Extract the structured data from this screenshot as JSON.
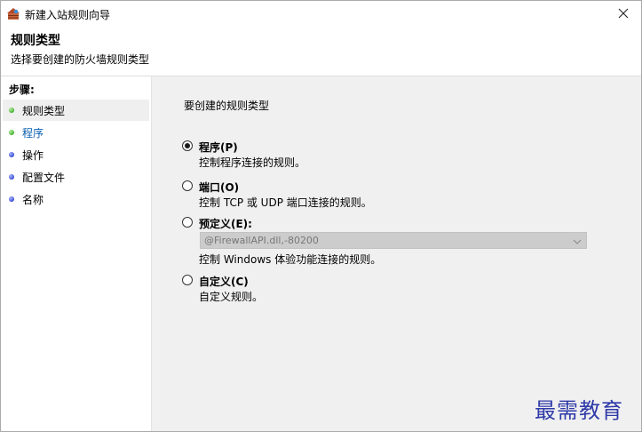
{
  "window": {
    "title": "新建入站规则向导"
  },
  "header": {
    "title": "规则类型",
    "subtitle": "选择要创建的防火墙规则类型"
  },
  "sidebar": {
    "steps_label": "步骤:",
    "items": [
      {
        "label": "规则类型",
        "status": "green"
      },
      {
        "label": "程序",
        "status": "green"
      },
      {
        "label": "操作",
        "status": "blue"
      },
      {
        "label": "配置文件",
        "status": "blue"
      },
      {
        "label": "名称",
        "status": "blue"
      }
    ]
  },
  "main": {
    "question": "要创建的规则类型",
    "options": [
      {
        "label": "程序(P)",
        "description": "控制程序连接的规则。",
        "checked": true
      },
      {
        "label": "端口(O)",
        "description": "控制 TCP 或 UDP 端口连接的规则。",
        "checked": false
      },
      {
        "label": "预定义(E):",
        "description": "控制 Windows 体验功能连接的规则。",
        "checked": false
      },
      {
        "label": "自定义(C)",
        "description": "自定义规则。",
        "checked": false
      }
    ],
    "predefined_select_value": "@FirewallAPI.dll,-80200"
  },
  "watermark": "最需教育",
  "colors": {
    "link": "#0a5fb0",
    "content_bg": "#f0f0f0",
    "watermark": "#2f3aa8"
  }
}
